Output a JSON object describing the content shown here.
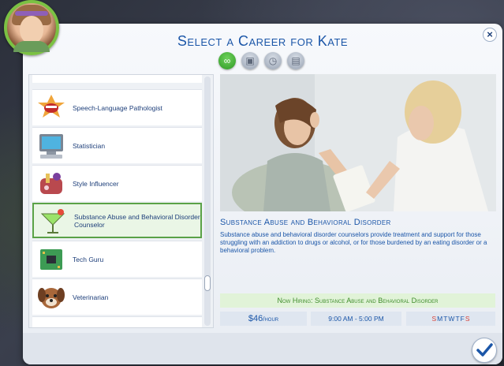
{
  "dialog": {
    "title": "Select a Career for Kate"
  },
  "filters": [
    {
      "name": "all-careers",
      "icon": "infinity-icon",
      "glyph": "∞",
      "active": true
    },
    {
      "name": "full-time",
      "icon": "briefcase-clock-icon",
      "glyph": "▣",
      "active": false
    },
    {
      "name": "part-time",
      "icon": "clock-icon",
      "glyph": "◷",
      "active": false
    },
    {
      "name": "freelance",
      "icon": "folder-icon",
      "glyph": "▤",
      "active": false
    }
  ],
  "careers": [
    {
      "label": "Speech-Language Pathologist",
      "icon": "speech-mouth-icon",
      "selected": false
    },
    {
      "label": "Statistician",
      "icon": "computer-monitor-icon",
      "selected": false
    },
    {
      "label": "Style Influencer",
      "icon": "makeup-bag-icon",
      "selected": false
    },
    {
      "label": "Substance Abuse and Behavioral Disorder Counselor",
      "icon": "cocktail-glass-icon",
      "selected": true
    },
    {
      "label": "Tech Guru",
      "icon": "circuit-board-icon",
      "selected": false
    },
    {
      "label": "Veterinarian",
      "icon": "dog-face-icon",
      "selected": false
    }
  ],
  "detail": {
    "title": "Substance Abuse and Behavioral Disorder",
    "description": "Substance abuse and behavioral disorder counselors provide treatment and support for those struggling with an addiction to drugs or alcohol, or for those burdened by an eating disorder or a behavioral problem.",
    "hiring": "Now Hiring: Substance Abuse and Behavioral Disorder",
    "pay_value": "$46",
    "pay_unit": "/hour",
    "hours": "9:00 AM - 5:00 PM",
    "days": [
      {
        "d": "S",
        "work": false
      },
      {
        "d": "M",
        "work": true
      },
      {
        "d": "T",
        "work": true
      },
      {
        "d": "W",
        "work": true
      },
      {
        "d": "T",
        "work": true
      },
      {
        "d": "F",
        "work": true
      },
      {
        "d": "S",
        "work": false
      }
    ]
  },
  "colors": {
    "accent": "#1b56a8",
    "selected_border": "#5aa247",
    "hiring_text": "#3e8c2a",
    "off_day": "#d6433a"
  }
}
